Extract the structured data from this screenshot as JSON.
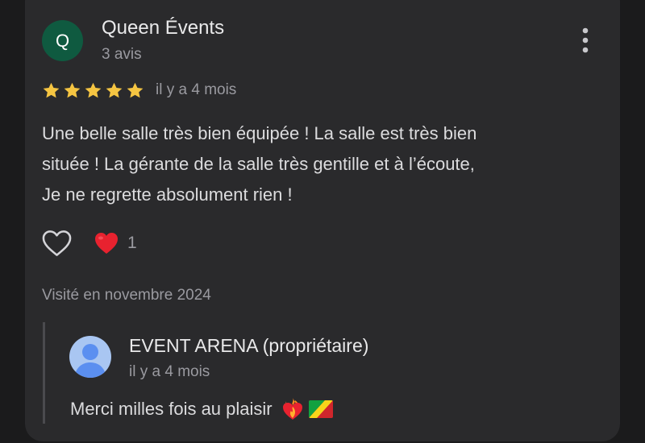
{
  "review": {
    "avatar_letter": "Q",
    "reviewer_name": "Queen Évents",
    "reviewer_meta": "3 avis",
    "rating": 5,
    "date": "il y a 4 mois",
    "text_lines": [
      "Une belle salle très bien équipée ! La salle est très bien",
      "située ! La gérante de la salle très gentille et à l’écoute,",
      "Je ne regrette absolument rien !"
    ],
    "reaction_count": "1",
    "visited": "Visité en novembre 2024"
  },
  "owner_reply": {
    "name": "EVENT ARENA (propriétaire)",
    "date": "il y a 4 mois",
    "text": "Merci milles fois au plaisir"
  },
  "icons": {
    "menu": "more-vert-icon",
    "star": "star-icon",
    "like": "heart-outline-icon",
    "reaction": "red-heart-emoji-icon",
    "reply_emoji_1": "heart-on-fire-emoji-icon",
    "reply_emoji_2": "congo-flag-emoji-icon"
  },
  "colors": {
    "background": "#1b1b1c",
    "card": "#2a2a2c",
    "avatar": "#0f5a40",
    "star": "#f5c542",
    "primary_text": "#e9e9ea",
    "secondary_text": "#9a9aa0"
  }
}
